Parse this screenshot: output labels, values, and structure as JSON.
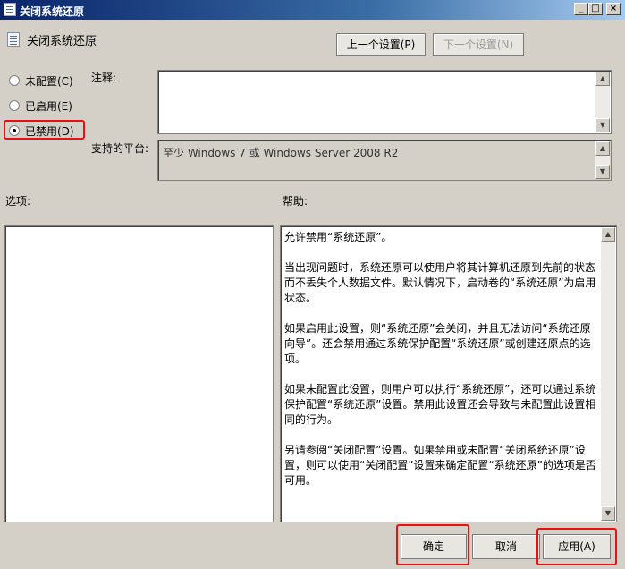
{
  "window": {
    "title": "关闭系统还原"
  },
  "header": {
    "policy_name": "关闭系统还原",
    "prev_button": "上一个设置(P)",
    "next_button": "下一个设置(N)"
  },
  "state": {
    "options": [
      {
        "label": "未配置(C)",
        "selected": false
      },
      {
        "label": "已启用(E)",
        "selected": false
      },
      {
        "label": "已禁用(D)",
        "selected": true
      }
    ]
  },
  "comment": {
    "label": "注释:",
    "value": ""
  },
  "platform": {
    "label": "支持的平台:",
    "value": "至少 Windows 7 或 Windows Server 2008 R2"
  },
  "options_section": {
    "label": "选项:"
  },
  "help": {
    "label": "帮助:",
    "paragraphs": [
      "允许禁用“系统还原”。",
      "当出现问题时，系统还原可以使用户将其计算机还原到先前的状态而不丢失个人数据文件。默认情况下，启动卷的“系统还原”为启用状态。",
      "如果启用此设置，则“系统还原”会关闭，并且无法访问“系统还原向导”。还会禁用通过系统保护配置“系统还原”或创建还原点的选项。",
      "如果未配置此设置，则用户可以执行“系统还原”，还可以通过系统保护配置“系统还原”设置。禁用此设置还会导致与未配置此设置相同的行为。",
      "另请参阅“关闭配置”设置。如果禁用或未配置“关闭系统还原”设置，则可以使用“关闭配置”设置来确定配置“系统还原”的选项是否可用。"
    ]
  },
  "footer": {
    "ok": "确定",
    "cancel": "取消",
    "apply": "应用(A)"
  },
  "colors": {
    "highlight": "#e81010",
    "titlebar": "#0a246a"
  }
}
